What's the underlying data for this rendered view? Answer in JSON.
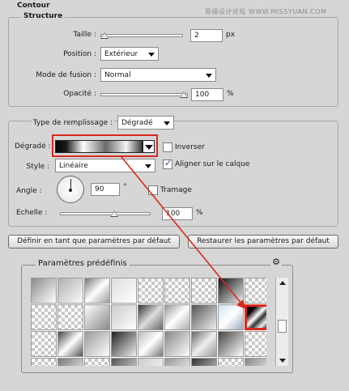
{
  "window": {
    "title": "Contour"
  },
  "watermark": "思缘设计论坛 WWW.MISSYUAN.COM",
  "structure": {
    "legend": "Structure",
    "taille": {
      "label": "Taille :",
      "value": "2",
      "unit": "px"
    },
    "position": {
      "label": "Position :",
      "selected": "Extérieur"
    },
    "mode": {
      "label": "Mode de fusion :",
      "selected": "Normal"
    },
    "opacite": {
      "label": "Opacité :",
      "value": "100",
      "unit": "%"
    }
  },
  "fill": {
    "type_label": "Type de remplissage :",
    "type_selected": "Dégradé",
    "gradient_label": "Dégradé :",
    "inverser_label": "Inverser",
    "inverser_checked": false,
    "style_label": "Style :",
    "style_selected": "Linéaire",
    "aligner_label": "Aligner sur le calque",
    "aligner_checked": true,
    "angle_label": "Angle :",
    "angle_value": "90",
    "angle_unit": "°",
    "tramage_label": "Tramage",
    "tramage_checked": false,
    "echelle_label": "Echelle :",
    "echelle_value": "100",
    "echelle_unit": "%"
  },
  "buttons": {
    "default_set": "Définir en tant que paramètres par défaut",
    "default_restore": "Restaurer les paramètres par défaut"
  },
  "presets": {
    "title": "Paramètres prédéfinis",
    "settings_icon": "gear-icon"
  },
  "colors": {
    "highlight": "#d8281f",
    "panel": "#d6d6d6"
  }
}
